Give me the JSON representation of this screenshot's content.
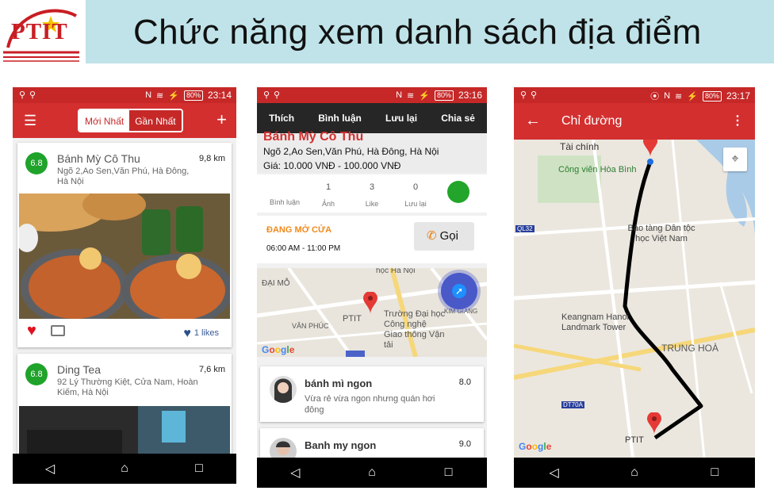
{
  "slide": {
    "title": "Chức năng xem danh sách địa điểm"
  },
  "logo": {
    "text": "PTIT"
  },
  "colors": {
    "brand_red": "#d32f2f",
    "title_band": "#bfe3e8",
    "score_green": "#1fa32b"
  },
  "phone1": {
    "status": {
      "battery": "80%",
      "time": "23:14"
    },
    "tabs": {
      "newest": "Mới Nhất",
      "nearest": "Gần Nhất"
    },
    "places": [
      {
        "score": "6.8",
        "name": "Bánh Mỳ Cô Thu",
        "address": "Ngõ 2,Ao Sen,Văn Phú, Hà Đông, Hà Nội",
        "distance": "9,8 km",
        "likes": "1 likes"
      },
      {
        "score": "6.8",
        "name": "Ding Tea",
        "address": "92 Lý Thường Kiệt, Cửa Nam, Hoàn Kiếm, Hà Nội",
        "distance": "7,6 km"
      }
    ]
  },
  "phone2": {
    "status": {
      "battery": "80%",
      "time": "23:16"
    },
    "tabs": [
      "Thích",
      "Bình luận",
      "Lưu lại",
      "Chia sẻ"
    ],
    "place": {
      "name": "Bánh Mỳ Cô Thu",
      "address": "Ngõ 2,Ao Sen,Văn Phú, Hà Đông, Hà Nội",
      "price": "Giá: 10.000 VNĐ - 100.000 VNĐ"
    },
    "stats": [
      {
        "value": "",
        "label": "Bình luận"
      },
      {
        "value": "1",
        "label": "Ảnh"
      },
      {
        "value": "3",
        "label": "Like"
      },
      {
        "value": "0",
        "label": "Lưu lại"
      }
    ],
    "open_status": "ĐANG MỞ CỬA",
    "hours": "06:00 AM - 11:00 PM",
    "call_label": "Gọi",
    "map_labels": {
      "l1": "học Hà Nội",
      "l2": "ĐẠI MỖ",
      "l3": "PTIT",
      "l4": "Trường Đại học Công nghệ Giao thông Vận tải",
      "l5": "VĂN PHÚC",
      "l6": "KIM GIANG"
    },
    "reviews": [
      {
        "title": "bánh mì ngon",
        "score": "8.0",
        "body": "Vừa rẻ vừa ngon nhưng quán hơi đông"
      },
      {
        "title": "Banh my ngon",
        "score": "9.0",
        "body": ""
      }
    ]
  },
  "phone3": {
    "status": {
      "battery": "80%",
      "time": "23:17"
    },
    "title": "Chỉ đường",
    "map_labels": {
      "taichinh": "Tài chính",
      "hoabinh": "Công viên Hòa Bình",
      "baotang": "Bảo tàng Dân tộc học Việt Nam",
      "keangnam": "Keangnam Hanoi Landmark Tower",
      "trunghoa": "TRUNG HOÀ",
      "ptit": "PTIT",
      "ql32": "QL32",
      "dt70a": "DT70A"
    }
  }
}
